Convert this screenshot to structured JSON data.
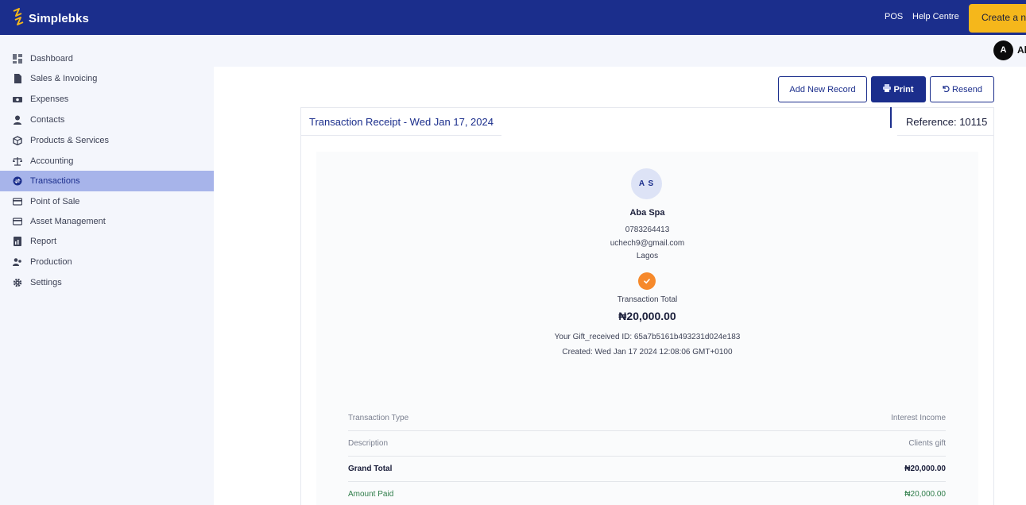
{
  "header": {
    "brand": "Simplebks",
    "links": [
      "POS",
      "Help Centre"
    ],
    "create_button": "Create a ne"
  },
  "user": {
    "initial": "A",
    "name": "Ab"
  },
  "sidebar": {
    "items": [
      {
        "label": "Dashboard",
        "icon": "dashboard-icon"
      },
      {
        "label": "Sales & Invoicing",
        "icon": "document-icon"
      },
      {
        "label": "Expenses",
        "icon": "cash-icon"
      },
      {
        "label": "Contacts",
        "icon": "person-icon"
      },
      {
        "label": "Products & Services",
        "icon": "box-icon"
      },
      {
        "label": "Accounting",
        "icon": "scale-icon"
      },
      {
        "label": "Transactions",
        "icon": "exchange-icon",
        "active": true
      },
      {
        "label": "Point of Sale",
        "icon": "card-icon"
      },
      {
        "label": "Asset Management",
        "icon": "card-icon"
      },
      {
        "label": "Report",
        "icon": "report-icon"
      },
      {
        "label": "Production",
        "icon": "people-icon"
      },
      {
        "label": "Settings",
        "icon": "gear-icon"
      }
    ]
  },
  "actions": {
    "add_new_record": "Add New Record",
    "print": "Print",
    "resend": "Resend"
  },
  "receipt": {
    "title": "Transaction Receipt - Wed Jan 17, 2024",
    "reference": "Reference: 10115",
    "initials": "A S",
    "business_name": "Aba Spa",
    "phone": "0783264413",
    "email": "uchech9@gmail.com",
    "city": "Lagos",
    "total_label": "Transaction Total",
    "total_amount": "₦20,000.00",
    "gift_id": "Your Gift_received ID: 65a7b5161b493231d024e183",
    "created": "Created: Wed Jan 17 2024 12:08:06 GMT+0100",
    "rows": [
      {
        "key": "Transaction Type",
        "value": "Interest Income"
      },
      {
        "key": "Description",
        "value": "Clients gift"
      },
      {
        "key": "Grand Total",
        "value": "₦20,000.00"
      },
      {
        "key": "Amount Paid",
        "value": "₦20,000.00"
      }
    ]
  },
  "colors": {
    "brand_blue": "#1b2e8c",
    "accent_yellow": "#f5b71b",
    "active_nav": "#a7b4ea",
    "check_orange": "#f6892b",
    "paid_green": "#2f7d4a"
  }
}
